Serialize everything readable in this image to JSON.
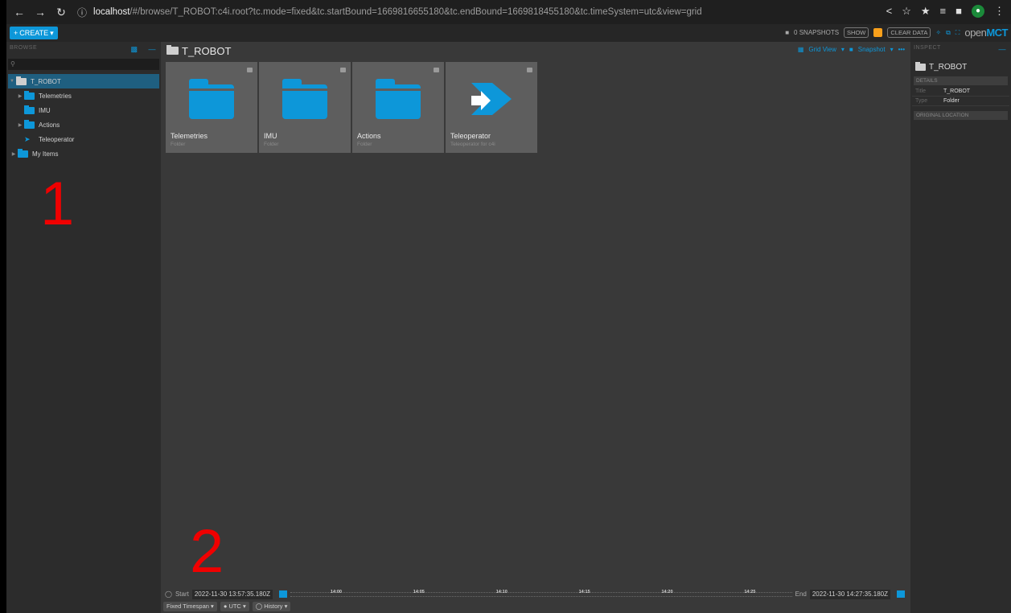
{
  "browser": {
    "url_host": "localhost",
    "url_path": "/#/browse/T_ROBOT:c4i.root?tc.mode=fixed&tc.startBound=1669816655180&tc.endBound=1669818455180&tc.timeSystem=utc&view=grid"
  },
  "header": {
    "create_label": "CREATE",
    "snapshots_label": "0 SNAPSHOTS",
    "show_label": "SHOW",
    "clear_data_label": "CLEAR DATA",
    "logo_open": "open",
    "logo_mct": "MCT"
  },
  "browse": {
    "pane_title": "BROWSE",
    "search_placeholder": "",
    "tree": [
      {
        "label": "T_ROBOT"
      },
      {
        "label": "Telemetries"
      },
      {
        "label": "IMU"
      },
      {
        "label": "Actions"
      },
      {
        "label": "Teleoperator"
      },
      {
        "label": "My Items"
      }
    ]
  },
  "main": {
    "title": "T_ROBOT",
    "grid_view_label": "Grid View",
    "snapshot_label": "Snapshot",
    "items": [
      {
        "name": "Telemetries",
        "type": "Folder"
      },
      {
        "name": "IMU",
        "type": "Folder"
      },
      {
        "name": "Actions",
        "type": "Folder"
      },
      {
        "name": "Teleoperator",
        "type": "Teleoperator for c4i"
      }
    ]
  },
  "annotations": {
    "one": "1",
    "two": "2"
  },
  "time": {
    "start_label": "Start",
    "start_value": "2022-11-30 13:57:35.180Z",
    "end_label": "End",
    "end_value": "2022-11-30 14:27:35.180Z",
    "ticks": [
      "14:00",
      "14:05",
      "14:10",
      "14:15",
      "14:20",
      "14:25"
    ],
    "mode_label": "Fixed Timespan",
    "timesystem_label": "UTC",
    "history_label": "History"
  },
  "inspect": {
    "pane_title": "INSPECT",
    "title": "T_ROBOT",
    "details_label": "DETAILS",
    "rows": [
      {
        "key": "Title",
        "value": "T_ROBOT"
      },
      {
        "key": "Type",
        "value": "Folder"
      }
    ],
    "original_location_label": "ORIGINAL LOCATION"
  },
  "colors": {
    "accent": "#0d97d9",
    "annotation": "#f00000"
  }
}
